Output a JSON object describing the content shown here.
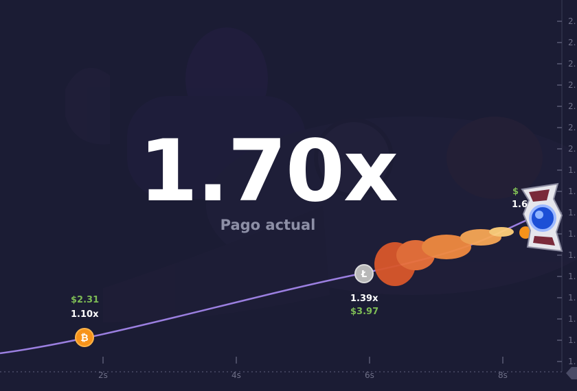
{
  "game": {
    "multiplier": "1.70x",
    "multiplier_caption": "Pago actual"
  },
  "markers": [
    {
      "amount": "$2.31",
      "multiplier": "1.10x",
      "coin": "bitcoin-coin-icon",
      "coin_color": "#f7931a"
    },
    {
      "multiplier": "1.39x",
      "amount": "$3.97",
      "coin": "litecoin-coin-icon",
      "coin_color": "#b8b8b8"
    },
    {
      "amount": "$",
      "multiplier": "1.6"
    }
  ],
  "x_axis": {
    "ticks": [
      "2s",
      "4s",
      "6s",
      "8s"
    ]
  },
  "y_axis": {
    "ticks": [
      "2.",
      "2.",
      "2.",
      "2.",
      "2.",
      "2.",
      "2.",
      "1.",
      "1.",
      "1.",
      "1.",
      "1.",
      "1.",
      "1.",
      "1.",
      "1.",
      "1."
    ]
  },
  "colors": {
    "background": "#1b1c34",
    "curve": "#9b7fe0",
    "flame": "#ff8a3d",
    "label_green": "#7dbb55"
  }
}
